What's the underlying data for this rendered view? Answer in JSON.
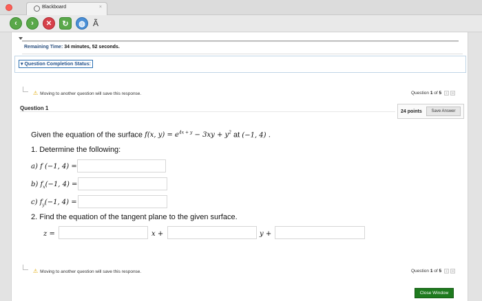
{
  "browser": {
    "tab_title": "Blackboard",
    "tab_close": "×",
    "toolbar": {
      "back_icon": "back-arrow",
      "forward_icon": "forward-arrow",
      "stop_icon": "stop-x",
      "reload_icon": "reload",
      "globe_icon": "globe",
      "text_button": "Ã"
    }
  },
  "timer": {
    "label": "Remaining Time:",
    "value": "34 minutes, 52 seconds."
  },
  "completion_status": "Question Completion Status:",
  "warning": "Moving to another question will save this response.",
  "question_counter": {
    "prefix": "Question",
    "current": "1",
    "middle": "of",
    "total": "5"
  },
  "question": {
    "title": "Question 1",
    "points": "24 points",
    "save_button": "Save Answer",
    "intro": "Given the equation of the surface",
    "func": "f(x, y) = e",
    "exponent": "4x + y",
    "func_rest": " − 3xy + y",
    "sq": "2",
    "at_label": "at",
    "point": "(−1, 4) .",
    "part1": "1.  Determine the following:",
    "a_label": "a)",
    "a_expr": "f (−1, 4) =",
    "b_label": "b)",
    "b_f": "f",
    "b_sub": "x",
    "b_expr": "(−1, 4) =",
    "c_label": "c)",
    "c_f": "f",
    "c_sub": "y",
    "c_expr": "(−1, 4) =",
    "part2": "2.  Find the equation of the tangent plane to the given surface.",
    "z_label": "z =",
    "x_label": "x +",
    "y_label": "y +"
  },
  "close_button": "Close Window",
  "colors": {
    "close_button": "#1e7a1e",
    "link_blue": "#2a6fb2",
    "warning_yellow": "#e0a800"
  }
}
